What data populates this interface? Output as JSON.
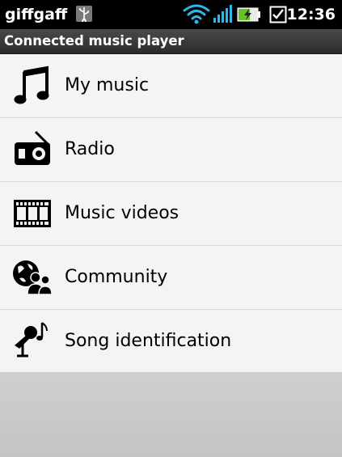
{
  "status_bar": {
    "carrier": "giffgaff",
    "time": "12:36",
    "icons": [
      "usb-icon",
      "wifi-icon",
      "signal-icon",
      "battery-charging-icon",
      "checkbox-notification-icon"
    ],
    "accent_color": "#33b5e5"
  },
  "title_bar": {
    "title": "Connected music player"
  },
  "menu": {
    "items": [
      {
        "label": "My music",
        "icon": "music-note-icon"
      },
      {
        "label": "Radio",
        "icon": "radio-icon"
      },
      {
        "label": "Music videos",
        "icon": "film-strip-icon"
      },
      {
        "label": "Community",
        "icon": "globe-people-icon"
      },
      {
        "label": "Song identification",
        "icon": "microphone-note-icon"
      }
    ]
  }
}
